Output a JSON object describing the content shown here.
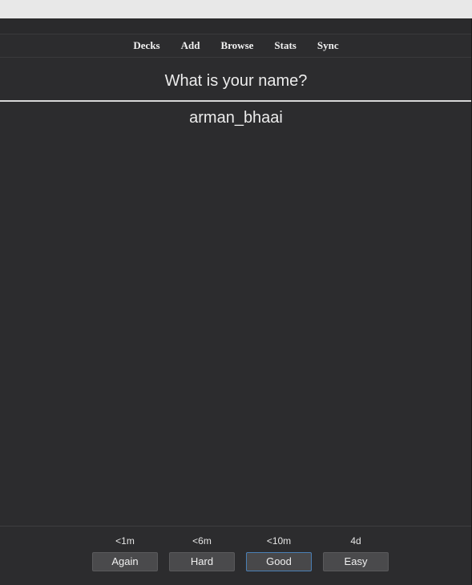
{
  "toolbar": {
    "items": [
      "Decks",
      "Add",
      "Browse",
      "Stats",
      "Sync"
    ]
  },
  "card": {
    "question": "What is your name?",
    "answer": "arman_bhaai"
  },
  "answer_buttons": [
    {
      "interval": "<1m",
      "label": "Again"
    },
    {
      "interval": "<6m",
      "label": "Hard"
    },
    {
      "interval": "<10m",
      "label": "Good"
    },
    {
      "interval": "4d",
      "label": "Easy"
    }
  ],
  "colors": {
    "background": "#2c2c2e",
    "button": "#4a4a4c",
    "focus_border": "#4a7fb5"
  }
}
